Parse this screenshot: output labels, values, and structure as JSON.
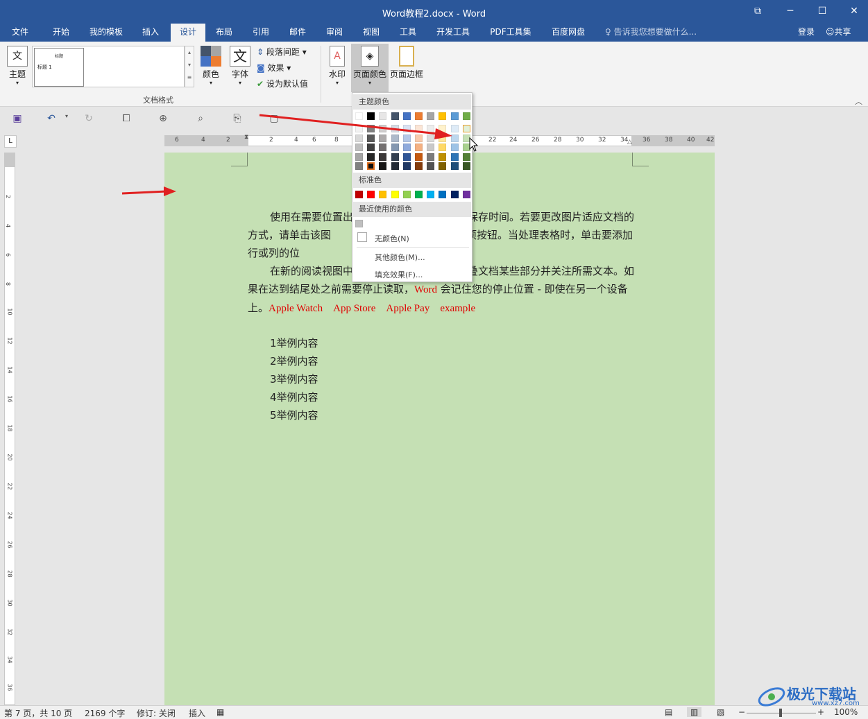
{
  "window": {
    "title": "Word教程2.docx - Word"
  },
  "tabs": [
    "文件",
    "开始",
    "我的模板",
    "插入",
    "设计",
    "布局",
    "引用",
    "邮件",
    "审阅",
    "视图",
    "工具",
    "开发工具",
    "PDF工具集",
    "百度网盘"
  ],
  "tell_me": "告诉我您想要做什么...",
  "account": {
    "login": "登录",
    "share": "共享"
  },
  "ribbon": {
    "theme_label": "主题",
    "style_preview": {
      "title": "标题",
      "heading1": "标题 1"
    },
    "colors_label": "颜色",
    "fonts_label": "字体",
    "fonts_icon_char": "文",
    "para_spacing_label": "段落间距",
    "effects_label": "效果",
    "set_default_label": "设为默认值",
    "group_label": "文档格式",
    "watermark_label": "水印",
    "page_color_label": "页面颜色",
    "page_border_label": "页面边框"
  },
  "dropdown": {
    "theme_colors_header": "主题颜色",
    "standard_colors_header": "标准色",
    "recent_colors_header": "最近使用的颜色",
    "no_color": "无颜色(N)",
    "more_colors": "其他颜色(M)...",
    "fill_effects": "填充效果(F)...",
    "theme_top_row": [
      "#ffffff",
      "#000000",
      "#e7e6e6",
      "#44546a",
      "#4472c4",
      "#ed7d31",
      "#a5a5a5",
      "#ffc000",
      "#5b9bd5",
      "#70ad47"
    ],
    "theme_shades": [
      [
        "#f2f2f2",
        "#7f7f7f",
        "#d0cece",
        "#d6dce5",
        "#d9e2f3",
        "#fbe5d6",
        "#ededed",
        "#fff2cc",
        "#deebf7",
        "#e2f0d9"
      ],
      [
        "#d9d9d9",
        "#595959",
        "#aeabab",
        "#adb9ca",
        "#b4c7e7",
        "#f8cbad",
        "#dbdbdb",
        "#ffe699",
        "#bdd7ee",
        "#c5e0b4"
      ],
      [
        "#bfbfbf",
        "#404040",
        "#757171",
        "#8497b0",
        "#8faadc",
        "#f4b183",
        "#c9c9c9",
        "#ffd966",
        "#9dc3e6",
        "#a9d18e"
      ],
      [
        "#a6a6a6",
        "#262626",
        "#3b3838",
        "#333f50",
        "#2f5597",
        "#c55a11",
        "#7b7b7b",
        "#bf9000",
        "#2e75b6",
        "#538135"
      ],
      [
        "#808080",
        "#0d0d0d",
        "#181717",
        "#222a35",
        "#1f3864",
        "#843c0c",
        "#525252",
        "#7f6000",
        "#1f4e79",
        "#385723"
      ]
    ],
    "standard": [
      "#c00000",
      "#ff0000",
      "#ffc000",
      "#ffff00",
      "#92d050",
      "#00b050",
      "#00b0f0",
      "#0070c0",
      "#002060",
      "#7030a0"
    ],
    "recent": [
      "#bfbfbf"
    ]
  },
  "document": {
    "paragraph1": "使用在需要位置出　　　　　　　　　　　保存时间。若要更改图片适应文档的方式，请单击该图　　　　　　　　　　布局选项按钮。当处理表格时，单击要添加行或列的位",
    "paragraph2_start": "在新的阅读视图中　　　　　　　　　　　叠文档某些部分并关注所需文本。如果在达到结尾处之前需要停止读取，",
    "word_red": "Word",
    "paragraph2_mid": " 会记住您的停止位置 - 即使在另一个设备上。",
    "red_terms": [
      "Apple Watch",
      "App Store",
      "Apple Pay",
      "example"
    ],
    "list_items": [
      "1举例内容",
      "2举例内容",
      "3举例内容",
      "4举例内容",
      "5举例内容"
    ]
  },
  "ruler": {
    "left_marks": [
      "6",
      "4",
      "2"
    ],
    "right_marks": [
      "2",
      "4",
      "6",
      "8",
      "22",
      "24",
      "26",
      "28",
      "30",
      "32",
      "34",
      "36",
      "38",
      "40",
      "42"
    ]
  },
  "vruler": [
    "2",
    "4",
    "6",
    "8",
    "10",
    "12",
    "14",
    "16",
    "18",
    "20",
    "22",
    "24",
    "26",
    "28",
    "30",
    "32",
    "34",
    "36"
  ],
  "statusbar": {
    "page": "第 7 页，共 10 页",
    "words": "2169 个字",
    "revision": "修订: 关闭",
    "mode": "插入",
    "zoom": "100%"
  },
  "watermark": {
    "text": "极光下载站",
    "url": "www.xz7.com"
  },
  "colors": {
    "title_blue": "#2b579a",
    "page_bg": "#c5e0b4",
    "arrow_red": "#e02020"
  }
}
